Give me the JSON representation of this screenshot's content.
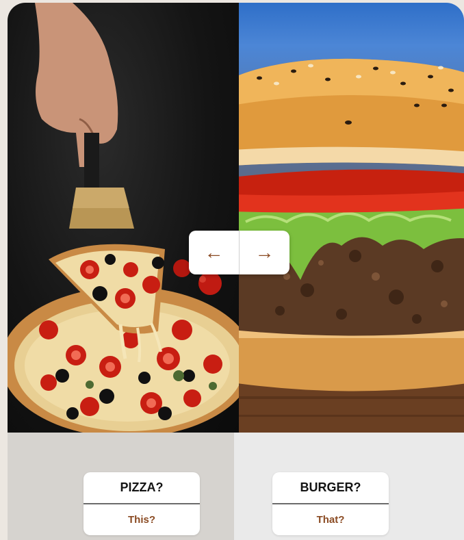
{
  "navigation": {
    "prev_icon": "arrow-left-icon",
    "prev_label": "←",
    "next_icon": "arrow-right-icon",
    "next_label": "→",
    "accent_color": "#8a4a22"
  },
  "options": [
    {
      "title": "PIZZA?",
      "action": "This?",
      "image": "pizza-photo"
    },
    {
      "title": "BURGER?",
      "action": "That?",
      "image": "burger-photo"
    }
  ]
}
